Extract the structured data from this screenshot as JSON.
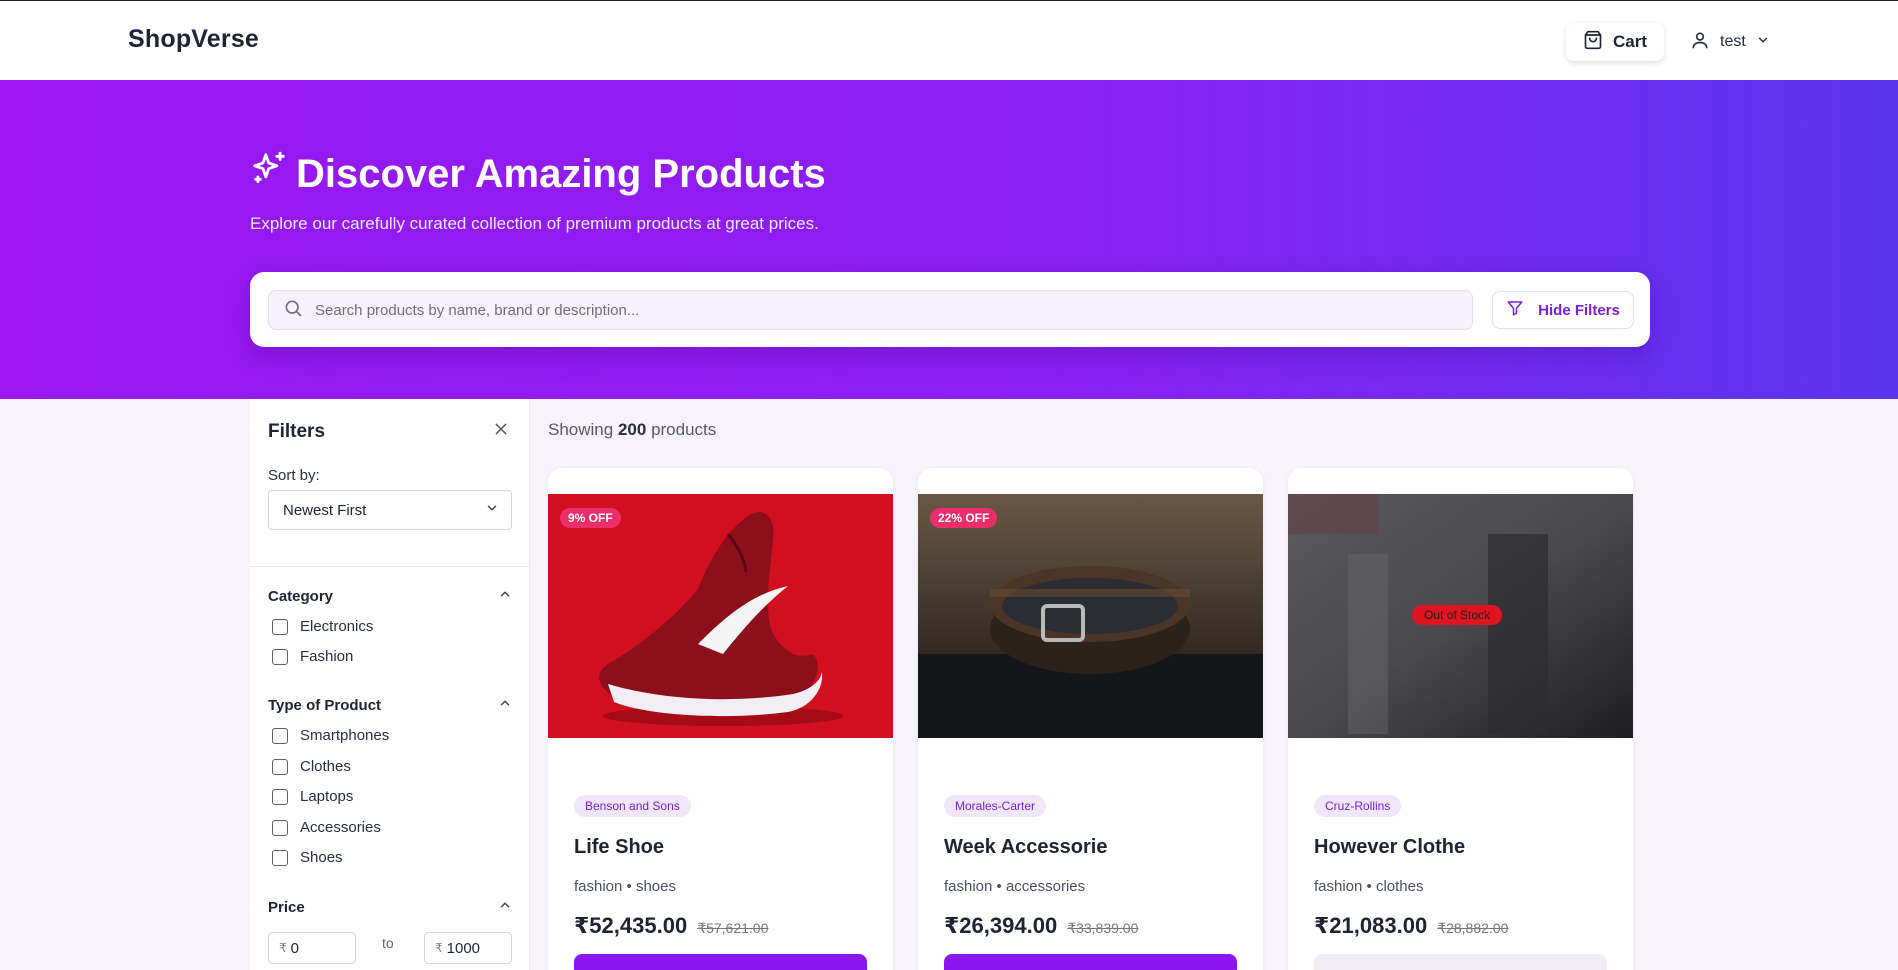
{
  "header": {
    "brand": "ShopVerse",
    "cart_label": "Cart",
    "user_name": "test"
  },
  "hero": {
    "title": "Discover Amazing Products",
    "subtitle": "Explore our carefully curated collection of premium products at great prices.",
    "search_placeholder": "Search products by name, brand or description...",
    "hide_filters_label": "Hide Filters"
  },
  "filters": {
    "title": "Filters",
    "sort_label": "Sort by:",
    "sort_value": "Newest First",
    "category": {
      "title": "Category",
      "options": [
        "Electronics",
        "Fashion"
      ]
    },
    "type": {
      "title": "Type of Product",
      "options": [
        "Smartphones",
        "Clothes",
        "Laptops",
        "Accessories",
        "Shoes"
      ]
    },
    "price": {
      "title": "Price",
      "currency": "₹",
      "min": "0",
      "max": "1000",
      "to_label": "to"
    }
  },
  "results": {
    "prefix": "Showing",
    "count": "200",
    "suffix": "products"
  },
  "products": [
    {
      "discount": "9% OFF",
      "brand": "Benson and Sons",
      "name": "Life Shoe",
      "category": "fashion • shoes",
      "price": "₹52,435.00",
      "original_price": "₹57,621.00",
      "in_stock": true
    },
    {
      "discount": "22% OFF",
      "brand": "Morales-Carter",
      "name": "Week Accessorie",
      "category": "fashion • accessories",
      "price": "₹26,394.00",
      "original_price": "₹33,839.00",
      "in_stock": true
    },
    {
      "status": "Out of Stock",
      "brand": "Cruz-Rollins",
      "name": "However Clothe",
      "category": "fashion • clothes",
      "price": "₹21,083.00",
      "original_price": "₹28,882.00",
      "in_stock": false
    }
  ],
  "colors": {
    "accent": "#8b16ef",
    "hero_start": "#9a17f2",
    "hero_end": "#5a35ee",
    "discount_badge": "#ec2d6b",
    "out_of_stock": "#e0141e"
  }
}
